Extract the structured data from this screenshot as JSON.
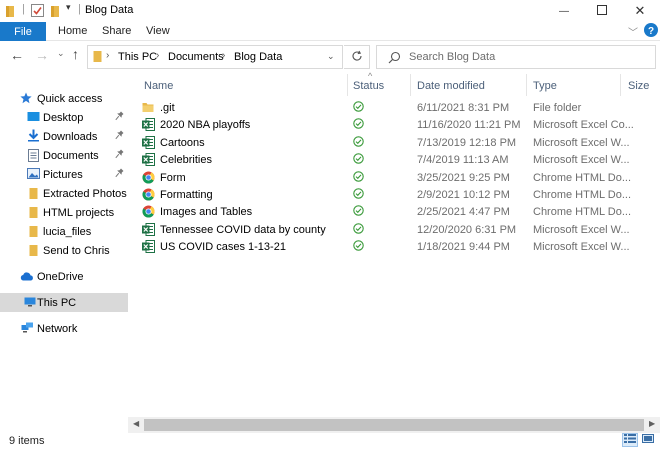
{
  "window": {
    "title": "Blog Data",
    "minimize_glyph": "—",
    "maximize_glyph": "☐",
    "close_glyph": "✕"
  },
  "ribbon": {
    "tabs": [
      "File",
      "Home",
      "Share",
      "View"
    ],
    "help_glyph": "?"
  },
  "address": {
    "crumbs": [
      "This PC",
      "Documents",
      "Blog Data"
    ]
  },
  "search": {
    "placeholder": "Search Blog Data"
  },
  "nav": {
    "quick_access": "Quick access",
    "items": [
      {
        "label": "Desktop",
        "icon": "desktop-icon",
        "pinned": true
      },
      {
        "label": "Downloads",
        "icon": "downloads-icon",
        "pinned": true
      },
      {
        "label": "Documents",
        "icon": "documents-icon",
        "pinned": true
      },
      {
        "label": "Pictures",
        "icon": "pictures-icon",
        "pinned": true
      },
      {
        "label": "Extracted Photos",
        "icon": "folder-icon",
        "pinned": false
      },
      {
        "label": "HTML projects",
        "icon": "folder-icon",
        "pinned": false
      },
      {
        "label": "lucia_files",
        "icon": "folder-icon",
        "pinned": false
      },
      {
        "label": "Send to Chris",
        "icon": "folder-icon",
        "pinned": false
      }
    ],
    "onedrive": "OneDrive",
    "this_pc": "This PC",
    "network": "Network"
  },
  "columns": {
    "name": "Name",
    "status": "Status",
    "date": "Date modified",
    "type": "Type",
    "size": "Size"
  },
  "files": [
    {
      "name": ".git",
      "date": "6/11/2021 8:31 PM",
      "type": "File folder",
      "icon": "folder-icon"
    },
    {
      "name": "2020 NBA playoffs",
      "date": "11/16/2020 11:21 PM",
      "type": "Microsoft Excel Co...",
      "icon": "excel-icon"
    },
    {
      "name": "Cartoons",
      "date": "7/13/2019 12:18 PM",
      "type": "Microsoft Excel W...",
      "icon": "excel-icon"
    },
    {
      "name": "Celebrities",
      "date": "7/4/2019 11:13 AM",
      "type": "Microsoft Excel W...",
      "icon": "excel-icon"
    },
    {
      "name": "Form",
      "date": "3/25/2021 9:25 PM",
      "type": "Chrome HTML Do...",
      "icon": "chrome-icon"
    },
    {
      "name": "Formatting",
      "date": "2/9/2021 10:12 PM",
      "type": "Chrome HTML Do...",
      "icon": "chrome-icon"
    },
    {
      "name": "Images and Tables",
      "date": "2/25/2021 4:47 PM",
      "type": "Chrome HTML Do...",
      "icon": "chrome-icon"
    },
    {
      "name": "Tennessee COVID data by county",
      "date": "12/20/2020 6:31 PM",
      "type": "Microsoft Excel W...",
      "icon": "excel-icon"
    },
    {
      "name": "US COVID cases 1-13-21",
      "date": "1/18/2021 9:44 PM",
      "type": "Microsoft Excel W...",
      "icon": "excel-icon"
    }
  ],
  "statusbar": {
    "count": "9 items"
  },
  "colors": {
    "accent": "#1979ca",
    "folder": "#e8b84a",
    "excel": "#1e7145",
    "sync_ok": "#3a9a3a",
    "selected_nav": "#d9d9d9"
  }
}
